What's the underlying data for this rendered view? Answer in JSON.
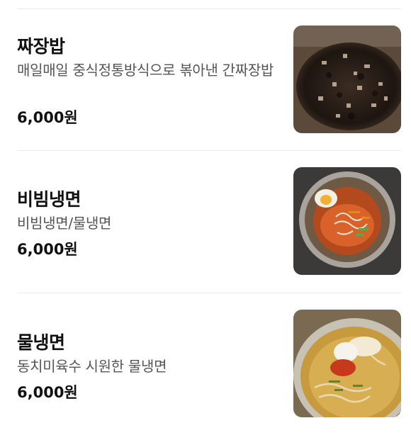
{
  "menu": {
    "items": [
      {
        "name": "짜장밥",
        "description": "매일매일 중식정통방식으로 볶아낸 간짜장밥",
        "price": "6,000원",
        "image_icon": "jjajang-rice-photo"
      },
      {
        "name": "비빔냉면",
        "description": "비빔냉면/물냉면",
        "price": "6,000원",
        "image_icon": "bibim-naengmyeon-photo"
      },
      {
        "name": "물냉면",
        "description": "동치미육수 시원한 물냉면",
        "price": "6,000원",
        "image_icon": "mul-naengmyeon-photo"
      }
    ]
  },
  "colors": {
    "text_primary": "#111111",
    "text_secondary": "#555555",
    "divider": "#ececec"
  }
}
